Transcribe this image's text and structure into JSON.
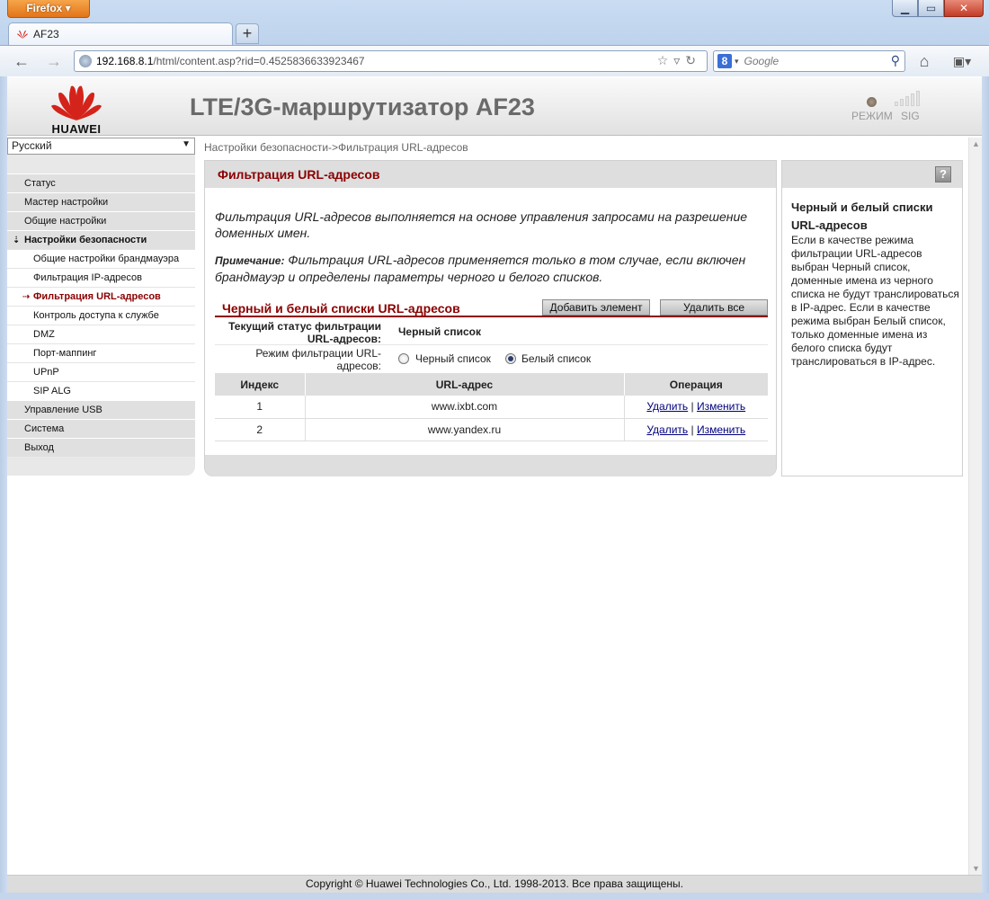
{
  "browser": {
    "app_button": "Firefox",
    "tab_title": "AF23",
    "url_host": "192.168.8.1",
    "url_path": "/html/content.asp?rid=0.4525836633923467",
    "search_placeholder": "Google"
  },
  "header": {
    "logo_text": "HUAWEI",
    "title": "LTE/3G-маршрутизатор AF23",
    "mode_label": "РЕЖИМ",
    "sig_label": "SIG"
  },
  "sidebar": {
    "language": "Русский",
    "items": [
      {
        "label": "Статус"
      },
      {
        "label": "Мастер настройки"
      },
      {
        "label": "Общие настройки"
      },
      {
        "label": "Настройки безопасности"
      },
      {
        "label": "Общие настройки брандмауэра"
      },
      {
        "label": "Фильтрация IP-адресов"
      },
      {
        "label": "Фильтрация URL-адресов"
      },
      {
        "label": "Контроль доступа к службе"
      },
      {
        "label": "DMZ"
      },
      {
        "label": "Порт-маппинг"
      },
      {
        "label": "UPnP"
      },
      {
        "label": "SIP ALG"
      },
      {
        "label": "Управление USB"
      },
      {
        "label": "Система"
      },
      {
        "label": "Выход"
      }
    ]
  },
  "breadcrumb": "Настройки безопасности->Фильтрация URL-адресов",
  "main": {
    "title": "Фильтрация URL-адресов",
    "description": "Фильтрация URL-адресов выполняется на основе управления запросами на разрешение доменных имен.",
    "note_label": "Примечание:",
    "note_text": " Фильтрация URL-адресов применяется только в том случае, если включен брандмауэр и определены параметры черного и белого списков.",
    "list_title": "Черный и белый списки URL-адресов",
    "add_button": "Добавить элемент",
    "delete_all_button": "Удалить все",
    "status_label": "Текущий статус фильтрации URL-адресов:",
    "status_value": "Черный список",
    "mode_label": "Режим фильтрации URL-адресов:",
    "mode_option_black": "Черный список",
    "mode_option_white": "Белый список",
    "mode_selected": "Белый список",
    "table": {
      "headers": [
        "Индекс",
        "URL-адрес",
        "Операция"
      ],
      "rows": [
        {
          "index": "1",
          "url": "www.ixbt.com",
          "delete": "Удалить",
          "edit": "Изменить"
        },
        {
          "index": "2",
          "url": "www.yandex.ru",
          "delete": "Удалить",
          "edit": "Изменить"
        }
      ]
    }
  },
  "help": {
    "title": "Черный и белый списки URL-адресов",
    "text": "Если в качестве режима фильтрации URL-адресов выбран Черный список, доменные имена из черного списка не будут транслироваться в IP-адрес. Если в качестве режима выбран Белый список, только доменные имена из белого списка будут транслироваться в IP-адрес."
  },
  "footer": "Copyright © Huawei Technologies Co., Ltd. 1998-2013. Все права защищены."
}
